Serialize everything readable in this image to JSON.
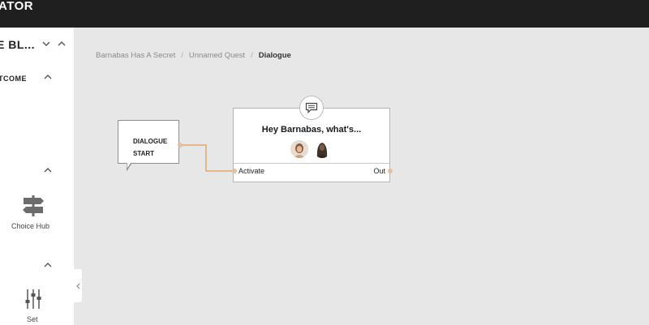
{
  "app": {
    "title": "ATOR"
  },
  "sidebar": {
    "header_title": "E BL...",
    "section_outcome": "TCOME",
    "items": [
      {
        "label": "Choice Hub",
        "icon": "signpost-icon"
      },
      {
        "label": "Set",
        "icon": "sliders-icon"
      }
    ]
  },
  "breadcrumb": {
    "items": [
      "Barnabas Has A Secret",
      "Unnamed Quest"
    ],
    "current": "Dialogue",
    "separator": "/"
  },
  "canvas": {
    "start_node": {
      "label": "DIALOGUE\nSTART"
    },
    "dialogue_node": {
      "title": "Hey Barnabas, what's...",
      "input_label": "Activate",
      "output_label": "Out",
      "icon": "chat-icon"
    },
    "connector_color": "#e0a96d"
  },
  "colors": {
    "topbar": "#1f1f1f",
    "canvas_bg": "#e7e7e7",
    "sidebar_bg": "#ffffff"
  }
}
